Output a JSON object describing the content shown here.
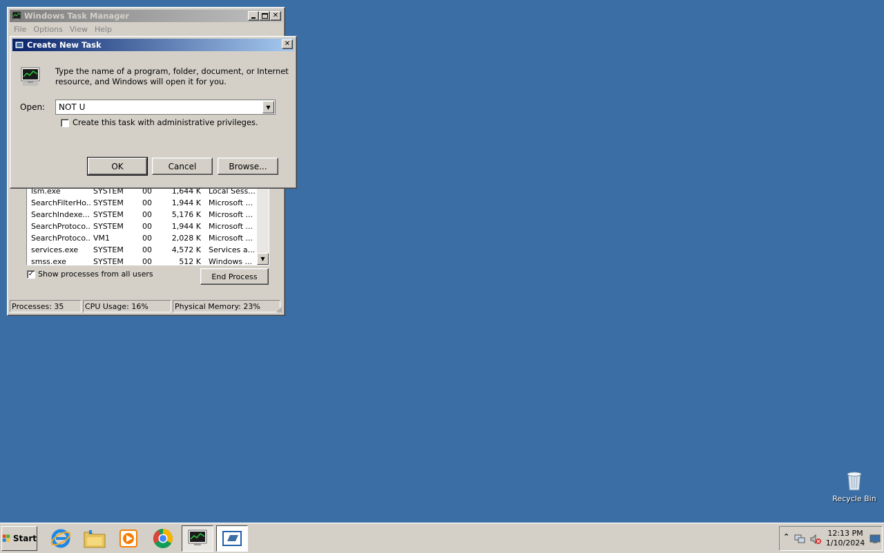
{
  "desktop": {
    "recycle_bin_label": "Recycle Bin"
  },
  "task_manager": {
    "title": "Windows Task Manager",
    "menu": [
      "File",
      "Options",
      "View",
      "Help"
    ],
    "processes": [
      {
        "name": "lsm.exe",
        "user": "SYSTEM",
        "cpu": "00",
        "mem": "1,644 K",
        "desc": "Local Sess..."
      },
      {
        "name": "SearchFilterHo...",
        "user": "SYSTEM",
        "cpu": "00",
        "mem": "1,944 K",
        "desc": "Microsoft ..."
      },
      {
        "name": "SearchIndexe...",
        "user": "SYSTEM",
        "cpu": "00",
        "mem": "5,176 K",
        "desc": "Microsoft ..."
      },
      {
        "name": "SearchProtoco...",
        "user": "SYSTEM",
        "cpu": "00",
        "mem": "1,944 K",
        "desc": "Microsoft ..."
      },
      {
        "name": "SearchProtoco...",
        "user": "VM1",
        "cpu": "00",
        "mem": "2,028 K",
        "desc": "Microsoft ..."
      },
      {
        "name": "services.exe",
        "user": "SYSTEM",
        "cpu": "00",
        "mem": "4,572 K",
        "desc": "Services a..."
      },
      {
        "name": "smss.exe",
        "user": "SYSTEM",
        "cpu": "00",
        "mem": "512 K",
        "desc": "Windows ..."
      }
    ],
    "show_all_users_label": "Show processes from all users",
    "show_all_users_checked": true,
    "end_process_label": "End Process",
    "status": {
      "processes": "Processes: 35",
      "cpu": "CPU Usage: 16%",
      "memory": "Physical Memory: 23%"
    }
  },
  "create_task": {
    "title": "Create New Task",
    "description_line1": "Type the name of a program, folder, document, or Internet",
    "description_line2": "resource, and Windows will open it for you.",
    "open_label": "Open:",
    "open_value": "NOT U",
    "admin_label": "Create this task with administrative privileges.",
    "admin_checked": false,
    "ok_label": "OK",
    "cancel_label": "Cancel",
    "browse_label": "Browse..."
  },
  "taskbar": {
    "start_label": "Start",
    "pinned": [
      "internet-explorer-icon",
      "windows-explorer-icon",
      "media-player-icon",
      "chrome-icon",
      "task-manager-icon",
      "create-task-icon"
    ],
    "clock_time": "12:13 PM",
    "clock_date": "1/10/2024"
  }
}
